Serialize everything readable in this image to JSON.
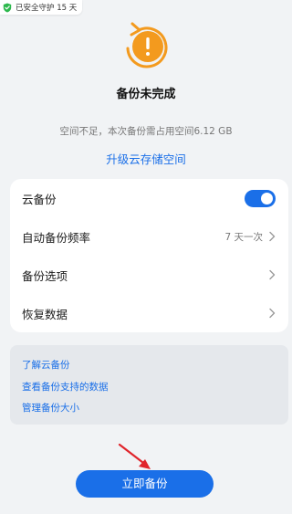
{
  "security_badge": {
    "text": "已安全守护 15 天",
    "icon": "shield-check-icon",
    "color": "#2db84d"
  },
  "status": {
    "icon": "warning-exclamation-icon",
    "icon_color": "#f39a1e",
    "title": "备份未完成",
    "description": "空间不足，本次备份需占用空间6.12 GB"
  },
  "upgrade_link": "升级云存储空间",
  "settings": {
    "cloud_backup_label": "云备份",
    "cloud_backup_enabled": true,
    "frequency_label": "自动备份频率",
    "frequency_value": "7 天一次",
    "options_label": "备份选项",
    "restore_label": "恢复数据"
  },
  "help_links": [
    "了解云备份",
    "查看备份支持的数据",
    "管理备份大小"
  ],
  "primary_button": "立即备份",
  "colors": {
    "accent": "#1a6fe8",
    "annotation_arrow": "#e0242b"
  }
}
